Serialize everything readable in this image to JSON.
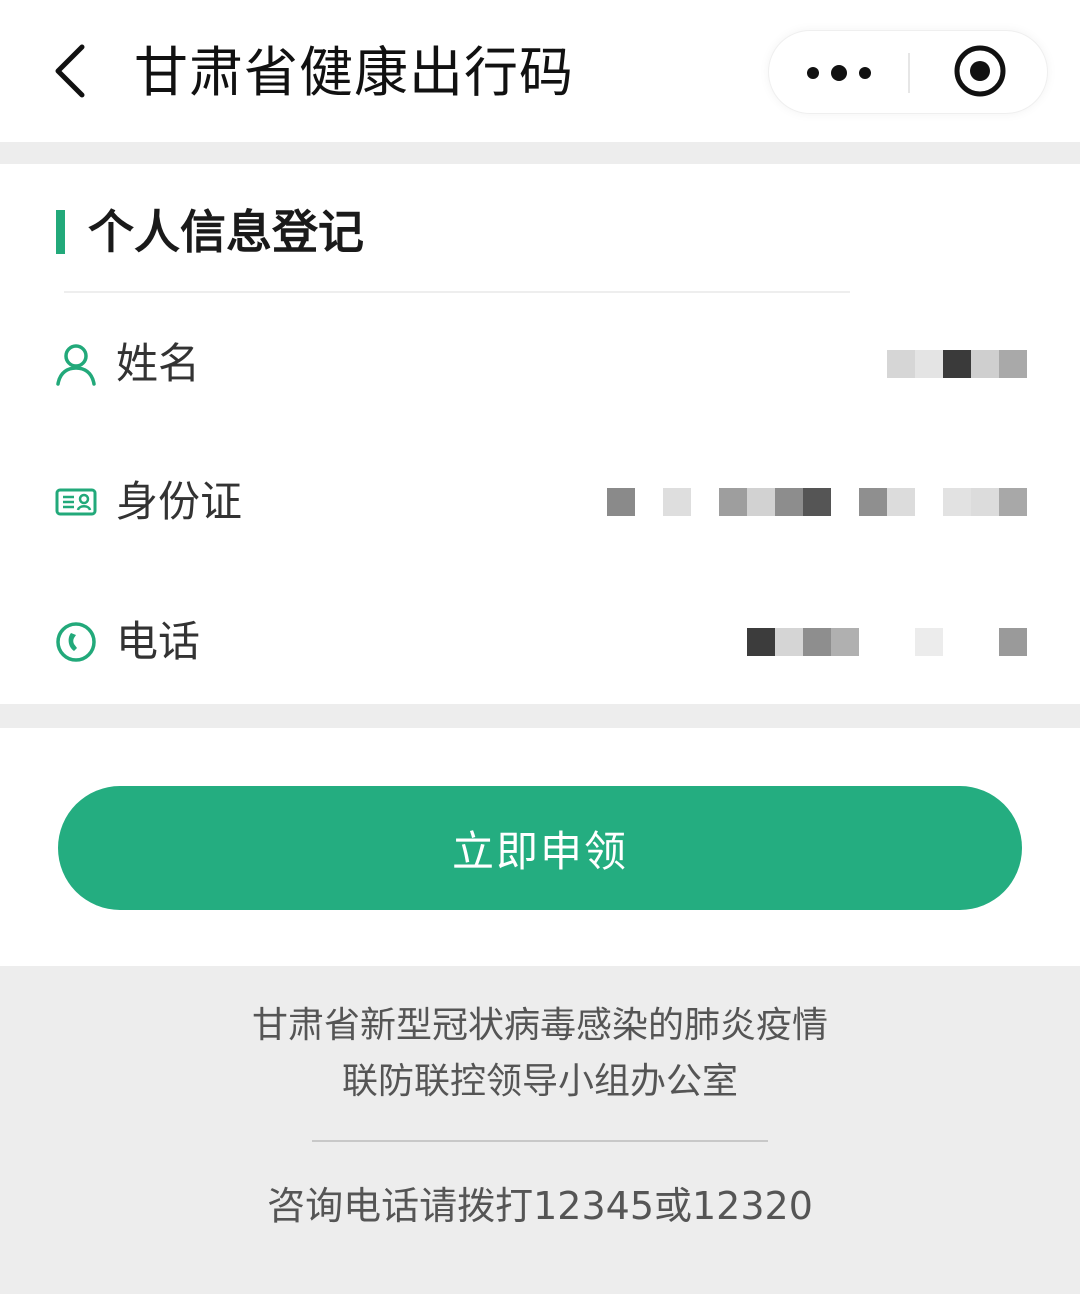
{
  "nav": {
    "title": "甘肃省健康出行码",
    "back_icon": "chevron-left-icon",
    "more_icon": "more-dots-icon",
    "close_icon": "target-circle-icon"
  },
  "section": {
    "title": "个人信息登记",
    "accent_color": "#22a97a"
  },
  "fields": [
    {
      "label": "姓名",
      "icon": "user-icon",
      "value": "",
      "masked": true
    },
    {
      "label": "身份证",
      "icon": "id-card-icon",
      "value": "",
      "masked": true
    },
    {
      "label": "电话",
      "icon": "phone-icon",
      "value": "",
      "masked": true
    }
  ],
  "apply_button": {
    "label": "立即申领",
    "color": "#24ad80"
  },
  "footer": {
    "org_line1": "甘肃省新型冠状病毒感染的肺炎疫情",
    "org_line2": "联防联控领导小组办公室",
    "hotline": "咨询电话请拨打12345或12320"
  }
}
